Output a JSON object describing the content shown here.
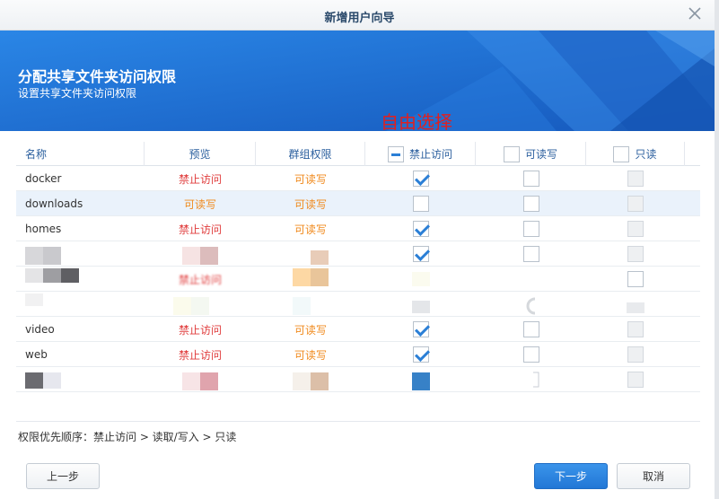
{
  "window": {
    "title": "新增用户向导"
  },
  "banner": {
    "title": "分配共享文件夹访问权限",
    "subtitle": "设置共享文件夹访问权限"
  },
  "annotation": "自由选择",
  "table": {
    "headers": {
      "name": "名称",
      "preview": "预览",
      "group": "群组权限",
      "deny": "禁止访问",
      "rw": "可读写",
      "ro": "只读"
    },
    "rows": [
      {
        "name": "docker",
        "preview": "禁止访问",
        "group": "可读写"
      },
      {
        "name": "downloads",
        "preview": "可读写",
        "group": "可读写"
      },
      {
        "name": "homes",
        "preview": "禁止访问",
        "group": "可读写"
      },
      {
        "name": "",
        "preview": "",
        "group": ""
      },
      {
        "name": "",
        "preview": "禁止访问",
        "group": ""
      },
      {
        "name": "",
        "preview": "",
        "group": ""
      },
      {
        "name": "video",
        "preview": "禁止访问",
        "group": "可读写"
      },
      {
        "name": "web",
        "preview": "禁止访问",
        "group": "可读写"
      },
      {
        "name": "",
        "preview": "",
        "group": ""
      }
    ]
  },
  "footer": {
    "priority": "权限优先顺序：禁止访问 > 读取/写入 > 只读"
  },
  "buttons": {
    "prev": "上一步",
    "next": "下一步",
    "cancel": "取消"
  },
  "colors": {
    "accent": "#2b7fd6",
    "deny": "#e03c3c",
    "rw": "#f08a1d",
    "banner": "#1e6fd4"
  }
}
